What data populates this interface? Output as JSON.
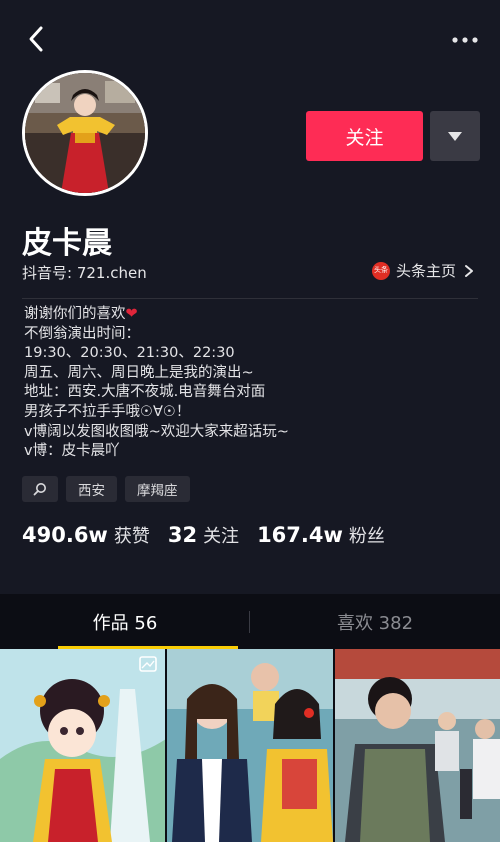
{
  "header": {
    "back_icon": "chevron-left-icon",
    "more_icon": "more-dots-icon"
  },
  "profile": {
    "nickname": "皮卡晨",
    "douyin_id": "抖音号: 721.chen",
    "follow_label": "关注",
    "dropdown_icon": "triangle-down-icon",
    "toutiao_logo_text": "头条",
    "toutiao_label": "头条主页"
  },
  "bio": {
    "line1": "谢谢你们的喜欢",
    "line2": "不倒翁演出时间：",
    "line3": "19:30、20:30、21:30、22:30",
    "line4": "周五、周六、周日晚上是我的演出~",
    "line5": "地址：西安.大唐不夜城.电音舞台对面",
    "line6": "男孩子不拉手手哦☉∀☉！",
    "line7": "v博阔以发图收图哦~欢迎大家来超话玩~",
    "line8": "v博：皮卡晨吖"
  },
  "tags": {
    "search_icon": "search-icon",
    "location": "西安",
    "zodiac": "摩羯座"
  },
  "stats": {
    "likes_num": "490.6w",
    "likes_label": "获赞",
    "following_num": "32",
    "following_label": "关注",
    "fans_num": "167.4w",
    "fans_label": "粉丝"
  },
  "tabs": {
    "works": "作品 56",
    "likes": "喜欢 382"
  },
  "colors": {
    "background": "#161823",
    "accent": "#fe2c55",
    "tab_indicator": "#facd06"
  }
}
